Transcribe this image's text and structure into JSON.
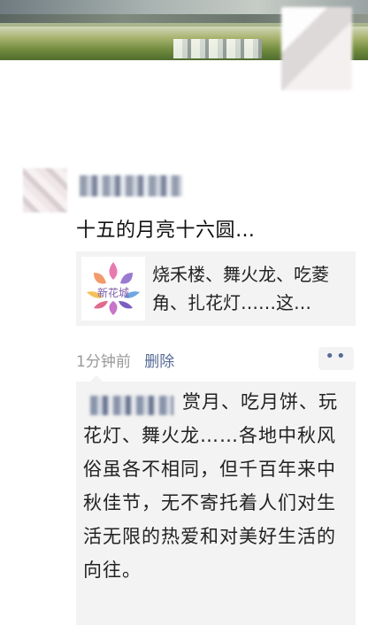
{
  "post": {
    "text": "十五的月亮十六圆…"
  },
  "link": {
    "thumb_label": "新花城",
    "title": "烧禾楼、舞火龙、吃菱角、扎花灯……这…"
  },
  "meta": {
    "time": "1分钟前",
    "delete_label": "删除",
    "more_label": "••"
  },
  "comment": {
    "text": "赏月、吃月饼、玩花灯、舞火龙……各地中秋风俗虽各不相同，但千百年来中秋佳节，无不寄托着人们对生活无限的热爱和对美好生活的向往。"
  },
  "colors": {
    "link_blue": "#576b95",
    "time_gray": "#999999",
    "card_bg": "#f3f3f3"
  }
}
